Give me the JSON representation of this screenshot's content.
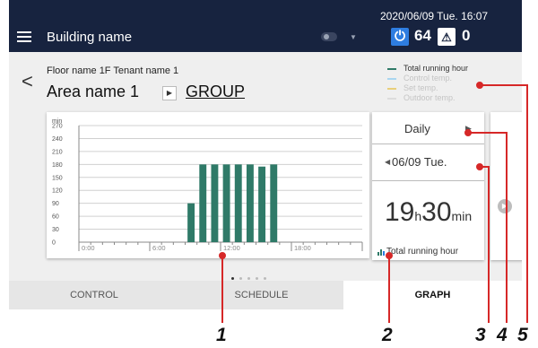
{
  "header": {
    "building_name": "Building name",
    "datetime": "2020/06/09 Tue. 16:07",
    "power_count": "64",
    "alarm_count": "0",
    "power_icon": "⏻",
    "alarm_icon": "⚠"
  },
  "area": {
    "back": "<",
    "floor_tenant": "Floor name 1F Tenant name 1",
    "area_name": "Area name 1",
    "group_link": "GROUP"
  },
  "legend": [
    {
      "label": "Total running hour",
      "color": "#2f7a68"
    },
    {
      "label": "Control temp.",
      "color": "#a9d6f0"
    },
    {
      "label": "Set temp.",
      "color": "#e8cf7a"
    },
    {
      "label": "Outdoor temp.",
      "color": "#dcdcdc"
    }
  ],
  "chart_data": {
    "type": "bar",
    "ylabel": "min",
    "yticks": [
      "270",
      "240",
      "210",
      "180",
      "150",
      "120",
      "90",
      "60",
      "30",
      "0"
    ],
    "xticks": [
      "0:00",
      "6:00",
      "12:00",
      "18:00"
    ],
    "ylim": [
      0,
      270
    ],
    "xlim": [
      0,
      24
    ],
    "x": [
      9,
      10,
      11,
      12,
      13,
      14,
      15,
      16
    ],
    "values": [
      90,
      180,
      180,
      180,
      180,
      180,
      175,
      180
    ],
    "bar_color": "#2f7a68"
  },
  "side": {
    "period": "Daily",
    "date": "06/09 Tue.",
    "value_hours": "19",
    "unit_h": "h",
    "value_min": "30",
    "unit_min": "min",
    "caption": "Total running hour"
  },
  "tabs": [
    "CONTROL",
    "SCHEDULE",
    "GRAPH"
  ],
  "callouts": [
    "1",
    "2",
    "3",
    "4",
    "5"
  ]
}
